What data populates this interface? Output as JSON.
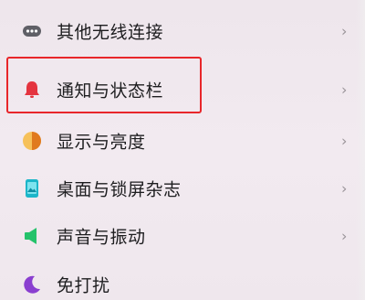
{
  "settings": {
    "items": [
      {
        "label": "其他无线连接",
        "icon": "more-dots-icon",
        "color": "#5f5f66"
      },
      {
        "label": "通知与状态栏",
        "icon": "bell-icon",
        "color": "#e4343f"
      },
      {
        "label": "显示与亮度",
        "icon": "brightness-icon",
        "color": "#f0a030"
      },
      {
        "label": "桌面与锁屏杂志",
        "icon": "wallpaper-icon",
        "color": "#1cb6c9"
      },
      {
        "label": "声音与振动",
        "icon": "speaker-icon",
        "color": "#25c26b"
      },
      {
        "label": "免打扰",
        "icon": "moon-icon",
        "color": "#8a3fd0"
      }
    ],
    "chevron": "›"
  }
}
